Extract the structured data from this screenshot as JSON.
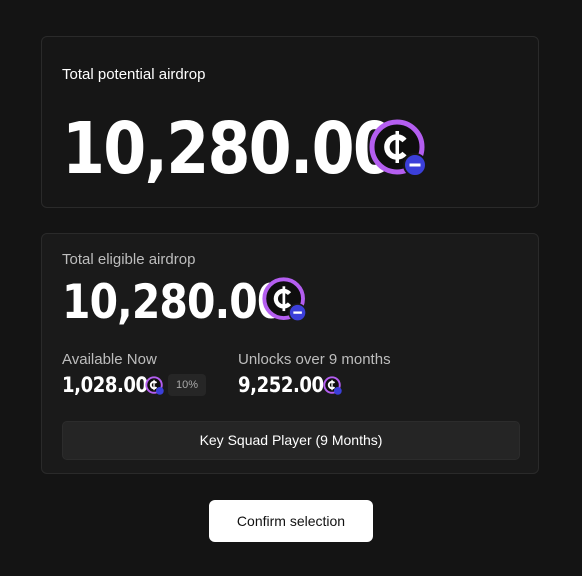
{
  "total_card": {
    "label": "Total potential airdrop",
    "amount": "10,280.00",
    "token_icon": "token-coin-icon"
  },
  "eligible_card": {
    "label": "Total eligible airdrop",
    "amount": "10,280.00",
    "available": {
      "label": "Available Now",
      "amount": "1,028.00",
      "percent": "10%"
    },
    "unlocks": {
      "label": "Unlocks over 9 months",
      "amount": "9,252.00"
    },
    "plan_button_label": "Key Squad Player (9 Months)"
  },
  "confirm_button_label": "Confirm selection",
  "colors": {
    "background": "#141414",
    "coin_ring": "#b45ef0",
    "coin_badge": "#3b3fd9",
    "button_bg": "#ffffff"
  }
}
